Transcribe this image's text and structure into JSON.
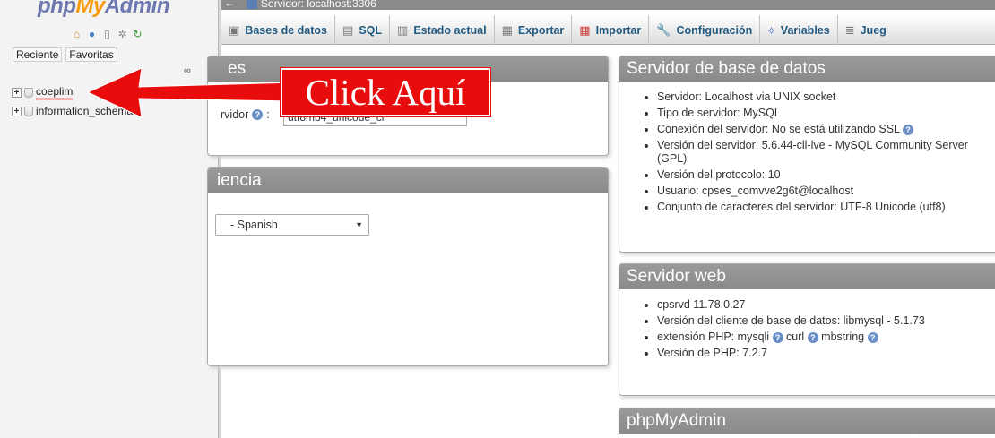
{
  "nav": {
    "logo": {
      "php": "php",
      "my": "My",
      "admin": "Admin"
    },
    "quick_icons": [
      "home-icon",
      "info-icon",
      "docs-icon",
      "settings-icon",
      "reload-icon"
    ],
    "tabs": [
      "Reciente",
      "Favoritas"
    ],
    "databases": [
      "coeplim",
      "information_schema"
    ]
  },
  "topbar": {
    "back": "←",
    "server": "Servidor: localhost:3306"
  },
  "menu": {
    "tabs": [
      {
        "label": "Bases de datos",
        "icon": "databases-icon"
      },
      {
        "label": "SQL",
        "icon": "sql-icon"
      },
      {
        "label": "Estado actual",
        "icon": "status-icon"
      },
      {
        "label": "Exportar",
        "icon": "export-icon"
      },
      {
        "label": "Importar",
        "icon": "import-icon"
      },
      {
        "label": "Configuración",
        "icon": "wrench-icon"
      },
      {
        "label": "Variables",
        "icon": "variables-icon"
      },
      {
        "label": "Jueg",
        "icon": "charsets-icon"
      }
    ]
  },
  "general": {
    "title": "es",
    "collation_label": "rvidor",
    "collation_value": "utf8mb4_unicode_ci"
  },
  "appearance": {
    "title": "iencia",
    "language": "- Spanish"
  },
  "db_server": {
    "title": "Servidor de base de datos",
    "items": [
      "Servidor: Localhost via UNIX socket",
      "Tipo de servidor: MySQL",
      "Conexión del servidor: No se está utilizando SSL",
      "Versión del servidor: 5.6.44-cll-lve - MySQL Community Server (GPL)",
      "Versión del protocolo: 10",
      "Usuario: cpses_comvve2g6t@localhost",
      "Conjunto de caracteres del servidor: UTF-8 Unicode (utf8)"
    ]
  },
  "web_server": {
    "title": "Servidor web",
    "items": [
      "cpsrvd 11.78.0.27",
      "Versión del cliente de base de datos: libmysql - 5.1.73"
    ],
    "php_ext_label": "extensión PHP:",
    "php_exts": [
      "mysqli",
      "curl",
      "mbstring"
    ],
    "php_version": "Versión de PHP: 7.2.7"
  },
  "pma": {
    "title": "phpMyAdmin"
  },
  "annotation": {
    "text": "Click Aquí",
    "color": "#e80c0c"
  }
}
